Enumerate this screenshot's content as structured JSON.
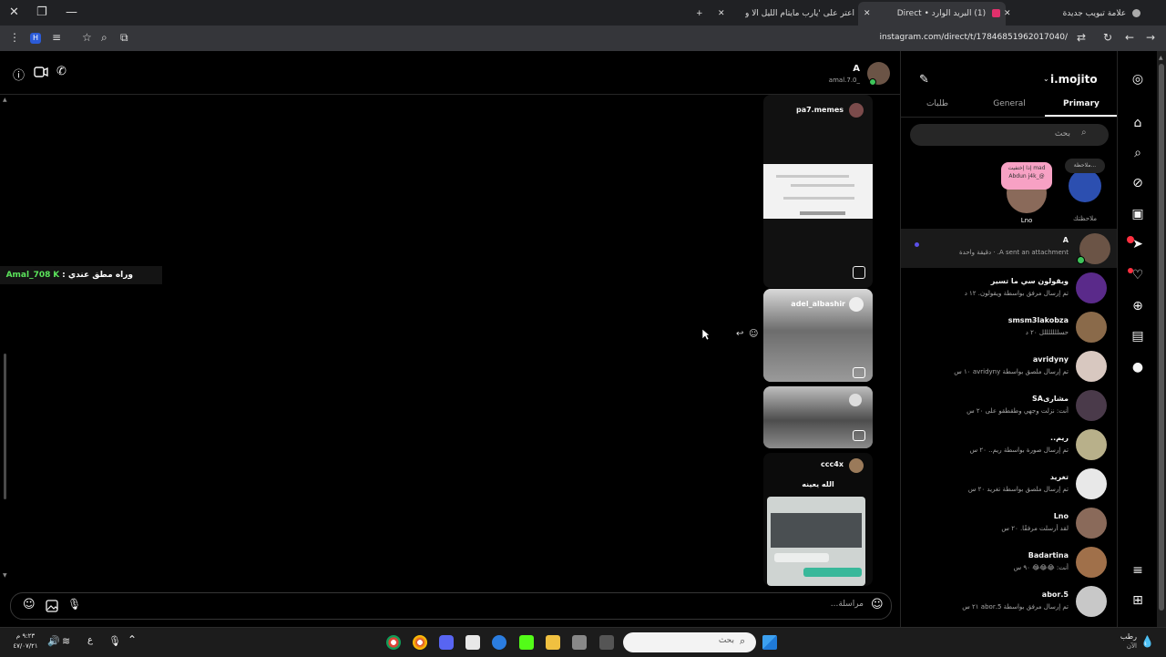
{
  "tabs": [
    {
      "title": "علامة تبويب جديدة"
    },
    {
      "title": "(1) البريد الوارد • Direct"
    },
    {
      "title": "اعتر على 'يارب مايتام الليل الا وانا"
    }
  ],
  "address": {
    "url": "instagram.com/direct/t/17846851962017040/"
  },
  "chat": {
    "header_name": "A",
    "header_sub": "amal.7.0_",
    "overlay_name": "Amal_708",
    "overlay_text": "وراه مطق عندي :",
    "composer_placeholder": "مراسلة...",
    "posts": [
      {
        "user": "pa7.memes"
      },
      {
        "user": "adel_albashir"
      },
      {
        "user": "ccc4x",
        "caption": "الله يعينه"
      }
    ]
  },
  "inbox": {
    "account": "i.mojito",
    "tabs": [
      "Primary",
      "General",
      "طلبات"
    ],
    "search_placeholder": "بحث",
    "notes": [
      {
        "label": "ملاحظتك",
        "bubble": "ملاحظة..."
      },
      {
        "label": "Lno",
        "bubble": "إذا إختفيت mad Abdun j4k_@"
      }
    ],
    "threads": [
      {
        "name": "A",
        "preview": "A sent an attachment. · دقيقة واحدة"
      },
      {
        "name": "ويقولون سي ما تسير",
        "preview": "تم إرسال مرفق بواسطة ويقولون. ١٢ د"
      },
      {
        "name": "smsm3lakobza",
        "preview": "حسلللللللل ٢٠ د"
      },
      {
        "name": "avridyny",
        "preview": "تم إرسال ملصق بواسطة avridyny ١٠ س"
      },
      {
        "name": "مشارىSA",
        "preview": "أنت: نزلت وجهي وطقطقو على ٢٠ س"
      },
      {
        "name": "ريم..",
        "preview": "تم إرسال صورة بواسطة ريم.. ٢٠ س"
      },
      {
        "name": "تغريد",
        "preview": "تم إرسال ملصق بواسطة تغريد ٢٠ س"
      },
      {
        "name": "Lno",
        "preview": "لقد أرسلت مرفقًا. ٢٠ س"
      },
      {
        "name": "Badartina",
        "preview": "أنت: 😂😂😂 ٩٠ س"
      },
      {
        "name": "5.abor",
        "preview": "تم إرسال مرفق بواسطة 5.abor ٢١ س"
      }
    ]
  },
  "taskbar": {
    "search_placeholder": "بحث",
    "clock_time": "٩:٢٣ م",
    "clock_date": "٤٧/٠٧/٢١",
    "weather": "رطب",
    "weather_sub": "الآن",
    "lang": "ع"
  },
  "colors": {
    "accent": "#0095f6",
    "bg": "#000000",
    "note_bubble": "#f7a1c4"
  }
}
